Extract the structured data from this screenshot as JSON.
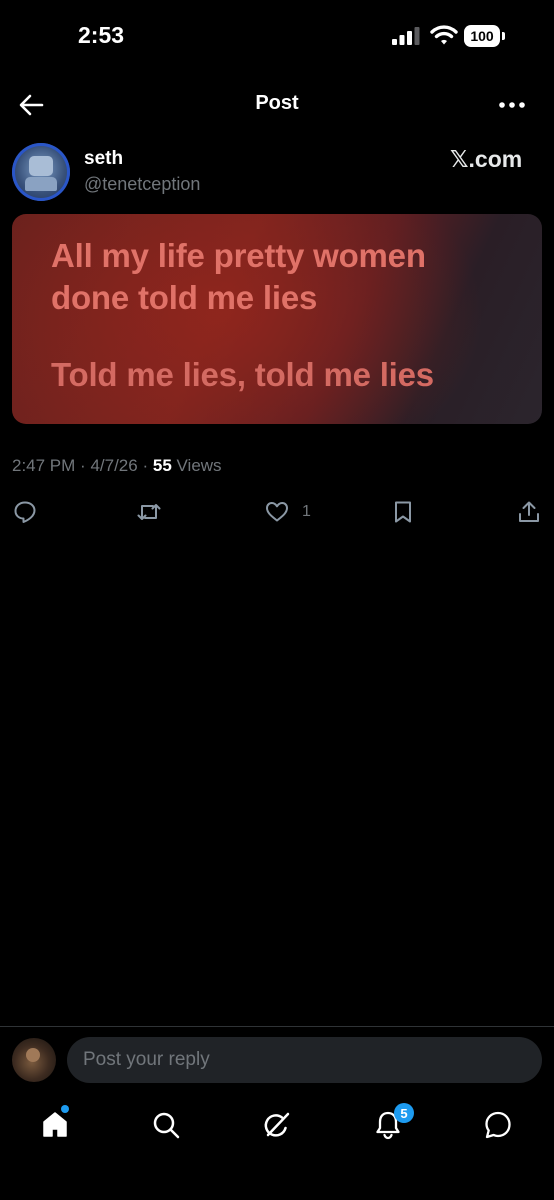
{
  "status_bar": {
    "time": "2:53",
    "battery": "100"
  },
  "header": {
    "title": "Post"
  },
  "post": {
    "author_name": "seth",
    "author_handle": "@tenetception",
    "source": "𝕏.com",
    "lyrics": [
      "All my life pretty women",
      "done told me lies",
      "Told me lies, told me lies"
    ],
    "time": "2:47 PM",
    "separator": "·",
    "date": "4/7/26",
    "views_count": "55",
    "views_label": "Views",
    "likes": "1"
  },
  "reply": {
    "placeholder": "Post your reply"
  },
  "tabbar": {
    "notifications_badge": "5"
  },
  "colors": {
    "accent": "#1d9bf0",
    "background": "#000000",
    "muted": "#71767b"
  }
}
